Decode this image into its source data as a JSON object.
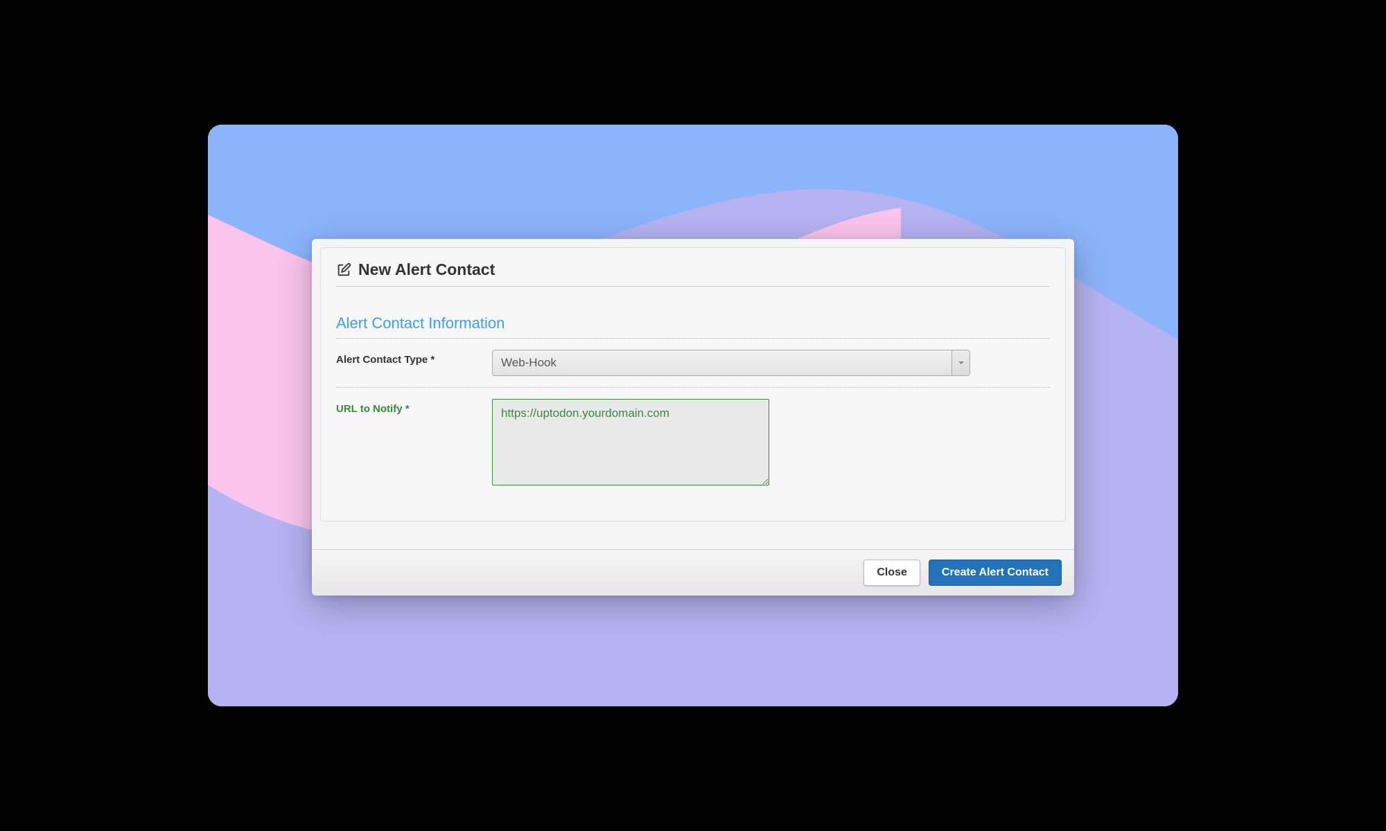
{
  "modal": {
    "title": "New Alert Contact",
    "section_title": "Alert Contact Information",
    "fields": {
      "type_label": "Alert Contact Type *",
      "type_value": "Web-Hook",
      "url_label": "URL to Notify *",
      "url_value": "https://uptodon.yourdomain.com"
    },
    "buttons": {
      "close": "Close",
      "create": "Create Alert Contact"
    }
  },
  "colors": {
    "accent_blue": "#3d9df6",
    "primary_btn": "#2372ba",
    "valid_green": "#3a8a3a"
  }
}
